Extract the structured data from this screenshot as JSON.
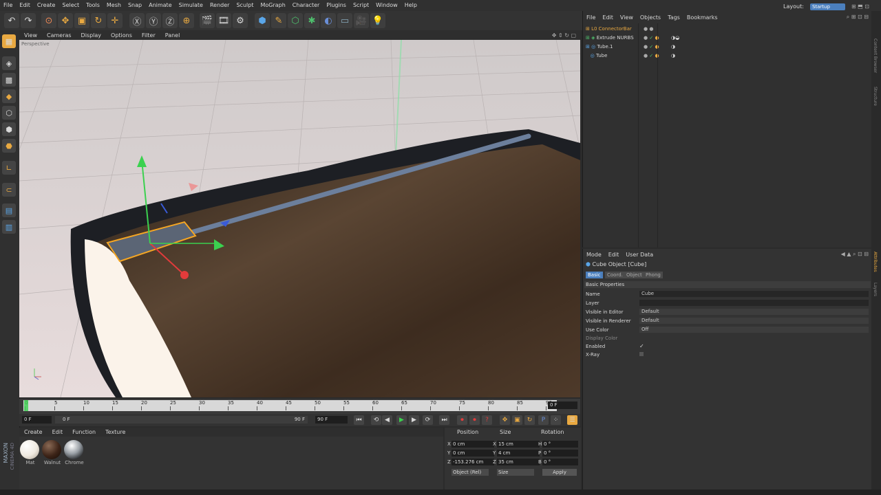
{
  "menu": [
    "File",
    "Edit",
    "Create",
    "Select",
    "Tools",
    "Mesh",
    "Snap",
    "Animate",
    "Simulate",
    "Render",
    "Sculpt",
    "MoGraph",
    "Character",
    "Plugins",
    "Script",
    "Window",
    "Help"
  ],
  "layout": {
    "label": "Layout:",
    "value": "Startup"
  },
  "viewport": {
    "menu": [
      "View",
      "Cameras",
      "Display",
      "Options",
      "Filter",
      "Panel"
    ],
    "label": "Perspective"
  },
  "timeline": {
    "ticks": [
      "0",
      "5",
      "10",
      "15",
      "20",
      "25",
      "30",
      "35",
      "40",
      "45",
      "50",
      "55",
      "60",
      "65",
      "70",
      "75",
      "80",
      "85",
      "90"
    ],
    "current": "0 F"
  },
  "transport": {
    "start": "0 F",
    "range_start": "0 F",
    "range_end": "90 F",
    "end": "90 F"
  },
  "materials": {
    "menu": [
      "Create",
      "Edit",
      "Function",
      "Texture"
    ],
    "items": [
      {
        "name": "Mat",
        "color": "#efe9df"
      },
      {
        "name": "Walnut",
        "color": "#3d2418"
      },
      {
        "name": "Chrome",
        "color": "#9aa0a6"
      }
    ]
  },
  "coords": {
    "headers": [
      "Position",
      "Size",
      "Rotation"
    ],
    "rows": [
      {
        "axis": "X",
        "pos": "0 cm",
        "saxis": "X",
        "size": "15 cm",
        "raxis": "H",
        "rot": "0 °"
      },
      {
        "axis": "Y",
        "pos": "0 cm",
        "saxis": "Y",
        "size": "4 cm",
        "raxis": "P",
        "rot": "0 °"
      },
      {
        "axis": "Z",
        "pos": "-153.276 cm",
        "saxis": "Z",
        "size": "35 cm",
        "raxis": "B",
        "rot": "0 °"
      }
    ],
    "mode": "Object (Rel)",
    "size_mode": "Size",
    "apply": "Apply"
  },
  "objects": {
    "menu": [
      "File",
      "Edit",
      "View",
      "Objects",
      "Tags",
      "Bookmarks"
    ],
    "items": [
      "ConnectorBar",
      "Extrude NURBS",
      "Tube.1",
      "Tube"
    ]
  },
  "attributes": {
    "menu": [
      "Mode",
      "Edit",
      "User Data"
    ],
    "title": "Cube Object [Cube]",
    "tabs": [
      "Basic",
      "Coord.",
      "Object",
      "Phong"
    ],
    "section": "Basic Properties",
    "props": [
      {
        "label": "Name",
        "value": "Cube"
      },
      {
        "label": "Layer",
        "value": ""
      },
      {
        "label": "Visible in Editor",
        "value": "Default"
      },
      {
        "label": "Visible in Renderer",
        "value": "Default"
      },
      {
        "label": "Use Color",
        "value": "Off"
      },
      {
        "label": "Display Color",
        "value": ""
      },
      {
        "label": "Enabled",
        "value": "✓"
      },
      {
        "label": "X-Ray",
        "value": ""
      }
    ]
  },
  "side": {
    "labels": [
      "Content Browser",
      "Structure",
      "Attributes",
      "Layers"
    ]
  },
  "brand": {
    "line1": "MAXON",
    "line2": "CINEMA 4D"
  },
  "colors": {
    "accent": "#4b7fbd",
    "selection": "#f5a623"
  }
}
